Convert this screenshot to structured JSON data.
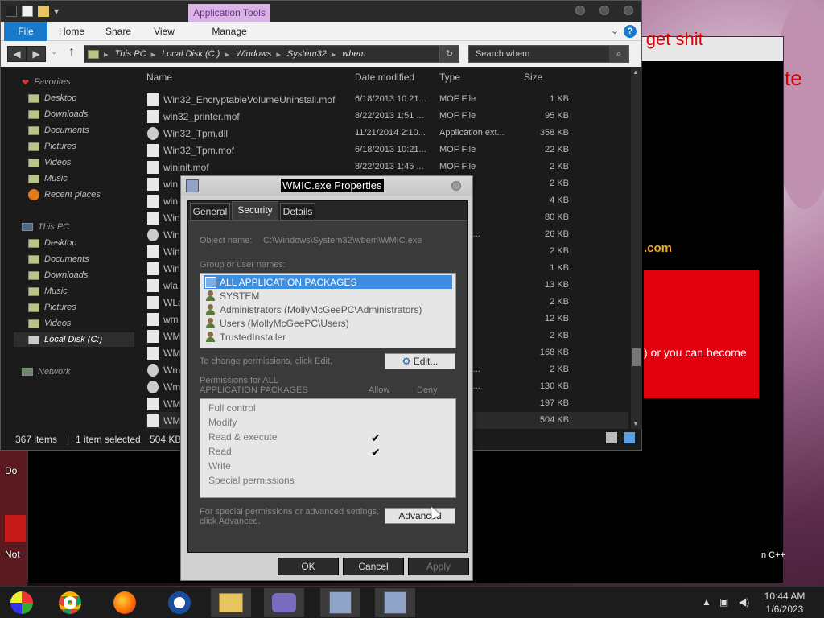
{
  "explorer": {
    "ribbon_context": "Application Tools",
    "tabs": [
      "File",
      "Home",
      "Share",
      "View",
      "Manage"
    ],
    "address_crumbs": [
      "This PC",
      "Local Disk (C:)",
      "Windows",
      "System32",
      "wbem"
    ],
    "search_placeholder": "Search wbem",
    "nav": {
      "favorites": "Favorites",
      "favorites_items": [
        "Desktop",
        "Downloads",
        "Documents",
        "Pictures",
        "Videos",
        "Music",
        "Recent places"
      ],
      "this_pc": "This PC",
      "this_pc_items": [
        "Desktop",
        "Documents",
        "Downloads",
        "Music",
        "Pictures",
        "Videos",
        "Local Disk (C:)"
      ],
      "network": "Network"
    },
    "columns": [
      "Name",
      "Date modified",
      "Type",
      "Size"
    ],
    "files": [
      {
        "name": "Win32_EncryptableVolumeUninstall.mof",
        "date": "6/18/2013 10:21...",
        "type": "MOF File",
        "size": "1 KB"
      },
      {
        "name": "win32_printer.mof",
        "date": "8/22/2013 1:51 ...",
        "type": "MOF File",
        "size": "95 KB"
      },
      {
        "name": "Win32_Tpm.dll",
        "date": "11/21/2014 2:10...",
        "type": "Application ext...",
        "size": "358 KB"
      },
      {
        "name": "Win32_Tpm.mof",
        "date": "6/18/2013 10:21...",
        "type": "MOF File",
        "size": "22 KB"
      },
      {
        "name": "wininit.mof",
        "date": "8/22/2013 1:45 ...",
        "type": "MOF File",
        "size": "2 KB"
      },
      {
        "name": "win",
        "date": "",
        "type": "e",
        "size": "2 KB"
      },
      {
        "name": "win",
        "date": "",
        "type": "e",
        "size": "4 KB"
      },
      {
        "name": "Win",
        "date": "",
        "type": "ation",
        "size": "80 KB"
      },
      {
        "name": "Win",
        "date": "",
        "type": "ation ext...",
        "size": "26 KB"
      },
      {
        "name": "Win",
        "date": "",
        "type": "e",
        "size": "2 KB"
      },
      {
        "name": "Win",
        "date": "",
        "type": "e",
        "size": "1 KB"
      },
      {
        "name": "wla",
        "date": "",
        "type": "e",
        "size": "13 KB"
      },
      {
        "name": "WLa",
        "date": "",
        "type": "e",
        "size": "2 KB"
      },
      {
        "name": "wm",
        "date": "",
        "type": "e",
        "size": "12 KB"
      },
      {
        "name": "WM",
        "date": "",
        "type": "e",
        "size": "2 KB"
      },
      {
        "name": "WM",
        "date": "",
        "type": "ation",
        "size": "168 KB"
      },
      {
        "name": "Wm",
        "date": "",
        "type": "ation ext...",
        "size": "2 KB"
      },
      {
        "name": "Wm",
        "date": "",
        "type": "ation ext...",
        "size": "130 KB"
      },
      {
        "name": "WM",
        "date": "",
        "type": "ation",
        "size": "197 KB"
      },
      {
        "name": "WM",
        "date": "",
        "type": "ation",
        "size": "504 KB"
      }
    ],
    "status": {
      "items": "367 items",
      "selected": "1 item selected",
      "size": "504 KB"
    }
  },
  "dialog": {
    "title": "WMIC.exe Properties",
    "tabs": [
      "General",
      "Security",
      "Details"
    ],
    "object_name_label": "Object name:",
    "object_name_value": "C:\\Windows\\System32\\wbem\\WMIC.exe",
    "group_label": "Group or user names:",
    "groups": [
      "ALL APPLICATION PACKAGES",
      "SYSTEM",
      "Administrators (MollyMcGeePC\\Administrators)",
      "Users (MollyMcGeePC\\Users)",
      "TrustedInstaller"
    ],
    "change_label": "To change permissions, click Edit.",
    "edit_button": "Edit...",
    "perm_label_1": "Permissions for ALL",
    "perm_label_2": "APPLICATION PACKAGES",
    "allow_label": "Allow",
    "deny_label": "Deny",
    "permissions": [
      {
        "name": "Full control",
        "allow": ""
      },
      {
        "name": "Modify",
        "allow": ""
      },
      {
        "name": "Read & execute",
        "allow": "✔"
      },
      {
        "name": "Read",
        "allow": "✔"
      },
      {
        "name": "Write",
        "allow": ""
      },
      {
        "name": "Special permissions",
        "allow": ""
      }
    ],
    "special_label_1": "For special permissions or advanced settings,",
    "special_label_2": "click Advanced.",
    "advanced_button": "Advanced",
    "ok": "OK",
    "cancel": "Cancel",
    "apply": "Apply"
  },
  "background": {
    "title_fragment": "e to get shit",
    "title_fragment_2": "te",
    "link_fragment": ".com",
    "redbox_text": ") or you can become",
    "cpp_fragment": "n C++",
    "desk_fragments": [
      "Do",
      "Not"
    ]
  },
  "taskbar": {
    "time": "10:44 AM",
    "date": "1/6/2023"
  }
}
